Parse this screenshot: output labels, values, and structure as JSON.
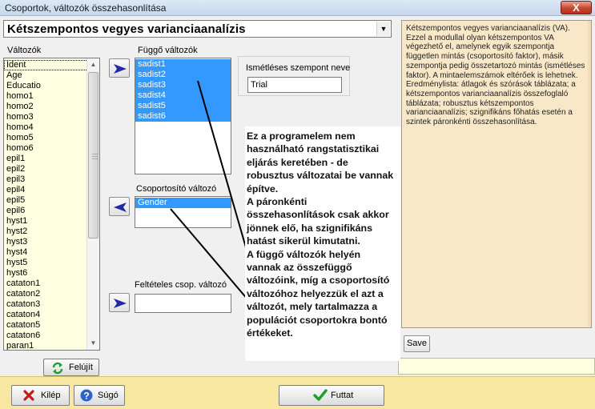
{
  "window": {
    "title": "Csoportok, változók összehasonlítása",
    "close_glyph": "X"
  },
  "procedure": {
    "selected": "Kétszempontos vegyes varianciaanalízis"
  },
  "variables": {
    "label": "Változók",
    "items": [
      "Ident",
      "Age",
      "Educatio",
      "homo1",
      "homo2",
      "homo3",
      "homo4",
      "homo5",
      "homo6",
      "epil1",
      "epil2",
      "epil3",
      "epil4",
      "epil5",
      "epil6",
      "hyst1",
      "hyst2",
      "hyst3",
      "hyst4",
      "hyst5",
      "hyst6",
      "cataton1",
      "cataton2",
      "cataton3",
      "cataton4",
      "cataton5",
      "cataton6",
      "paran1"
    ],
    "highlighted_item": "Ident"
  },
  "dependent": {
    "label": "Függő változók",
    "items": [
      "sadist1",
      "sadist2",
      "sadist3",
      "sadist4",
      "sadist5",
      "sadist6"
    ]
  },
  "grouping": {
    "label": "Csoportosító változó",
    "items": [
      "Gender"
    ]
  },
  "conditional": {
    "label": "Feltételes csop. változó",
    "value": ""
  },
  "repeated": {
    "label": "Ismétléses szempont neve",
    "value": "Trial"
  },
  "help": {
    "text": "Kétszempontos vegyes varianciaanalízis (VA). Ezzel a modullal olyan kétszempontos VA végezhető el, amelynek egyik szempontja független mintás (csoportosító faktor), másik szempontja pedig összetartozó mintás (ismétléses faktor). A mintaelemszámok eltérőek is lehetnek. Eredménylista: átlagok és szórások táblázata; a kétszempontos varianciaanalízis összefoglaló táblázata; robusztus kétszempontos varianciaanalízis; szignifikáns főhatás esetén a szintek páronkénti összehasonlítása."
  },
  "annotation": {
    "lines": [
      "Ez a programelem nem",
      "használható rangstatisztikai",
      "eljárás keretében - de",
      "robusztus változatai be vannak",
      "építve.",
      "A páronkénti",
      "összehasonlítások csak akkor",
      "jönnek elő, ha szignifikáns",
      "hatást sikerül kimutatni.",
      "A függő változók helyén",
      "vannak az összefüggő",
      "változóink, míg a csoportosító",
      "változóhoz helyezzük el azt a",
      "változót, mely tartalmazza a",
      "populációt csoportokra bontó",
      "értékeket."
    ]
  },
  "buttons": {
    "save": "Save",
    "refresh": "Felújít",
    "exit": "Kilép",
    "help": "Súgó",
    "run": "Futtat"
  },
  "colors": {
    "selection": "#3399ff",
    "list_bg": "#ffffe1",
    "help_bg": "#f8e8c7",
    "bottom_bar": "#f7e7a1",
    "arrow_blue": "#1f2aa8",
    "arrow_red": "#d01010"
  }
}
